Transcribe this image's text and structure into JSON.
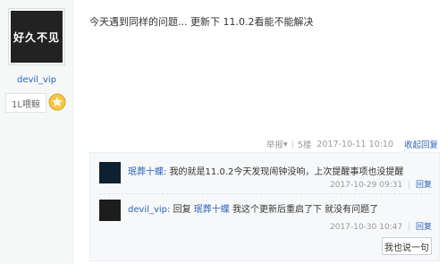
{
  "author": {
    "avatar_text": "好久不见",
    "username": "devil_vip",
    "floor": "1L喂鲸",
    "medal_icon": "star-medal-icon"
  },
  "post": {
    "content": "今天遇到同样的问题... 更新下 11.0.2看能不能解决",
    "report": "举报",
    "floor_num": "5楼",
    "time": "2017-10-11 10:10",
    "collapse": "收起回复"
  },
  "replies": [
    {
      "name": "珉葬十蝶:",
      "text": "我的就是11.0.2今天发现闹钟没响，上次提醒事项也没提醒",
      "time": "2017-10-29 09:31",
      "action": "回复"
    },
    {
      "name": "devil_vip:",
      "reply_word": "回复",
      "target": "珉葬十蝶",
      "text": "我这个更新后重启了下 就没有问题了",
      "time": "2017-10-30 10:47",
      "action": "回复"
    }
  ],
  "say_button": "我也说一句"
}
